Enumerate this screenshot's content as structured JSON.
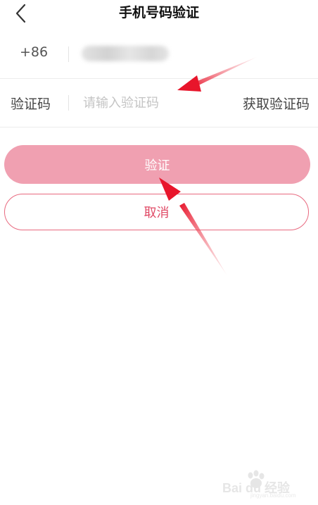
{
  "header": {
    "title": "手机号码验证",
    "back_icon": "chevron-left-icon"
  },
  "phone": {
    "prefix": "+86",
    "value": ""
  },
  "code": {
    "label": "验证码",
    "placeholder": "请输入验证码",
    "get_code_label": "获取验证码"
  },
  "actions": {
    "verify_label": "验证",
    "cancel_label": "取消"
  },
  "colors": {
    "primary_button": "#f0a0b1",
    "cancel_border": "#e8697f",
    "cancel_text": "#e04a66",
    "annotation_arrow": "#e8152b"
  },
  "watermark": {
    "brand": "Bai du 经验",
    "url": "jingyan.baidu.com"
  }
}
